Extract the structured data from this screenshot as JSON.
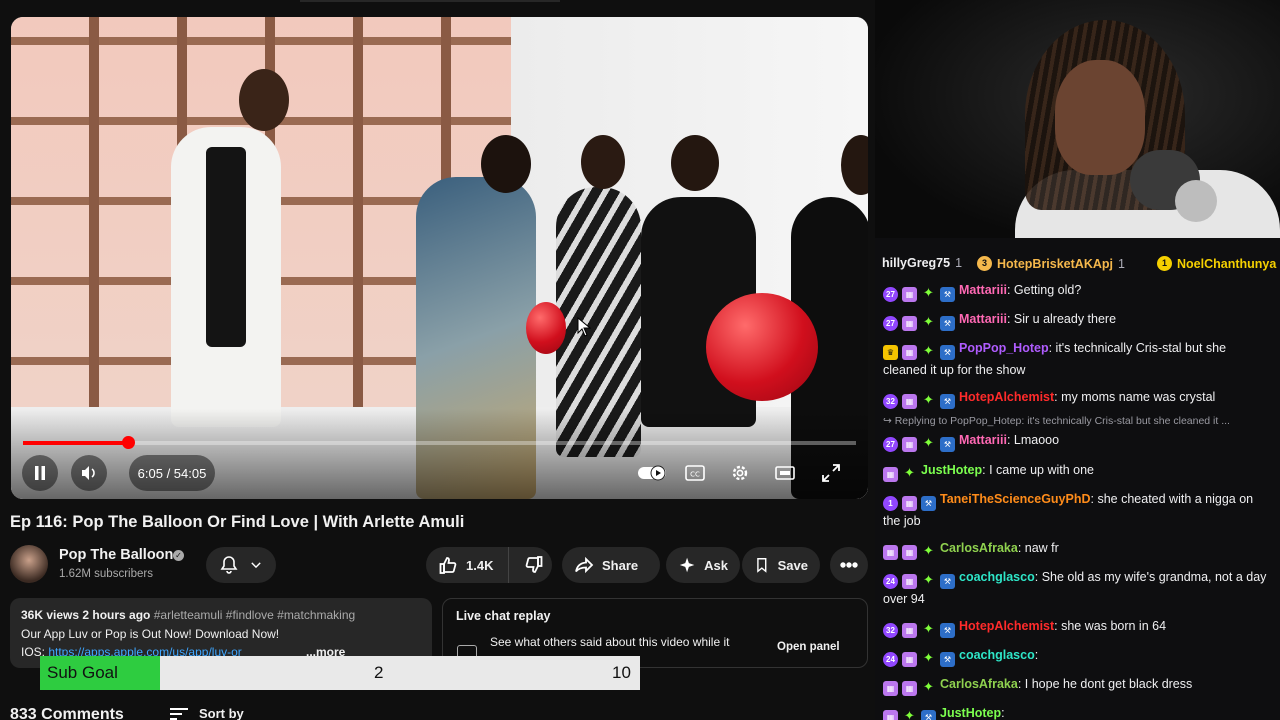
{
  "player": {
    "progress_fraction": 0.126,
    "time_display": "6:05 / 54:05"
  },
  "video": {
    "title": "Ep 116: Pop The Balloon Or Find Love | With Arlette Amuli"
  },
  "channel": {
    "name": "Pop The Balloon",
    "subscribers": "1.62M subscribers"
  },
  "actions": {
    "likes": "1.4K",
    "share_label": "Share",
    "ask_label": "Ask",
    "save_label": "Save"
  },
  "description": {
    "meta": "36K views  2 hours ago",
    "tags": "#arletteamuli #findlove #matchmaking",
    "line1": "Our App Luv or Pop is Out Now! Download Now!",
    "ios_prefix": "IOS: ",
    "ios_link": "https://apps.apple.com/us/app/luv-or",
    "more": "...more"
  },
  "live_chat": {
    "title": "Live chat replay",
    "desc": "See what others said about this video while it",
    "button": "Open panel"
  },
  "comments": {
    "count": "833 Comments",
    "sort_label": "Sort by"
  },
  "sub_goal": {
    "label": "Sub Goal",
    "current": "2",
    "target": "10",
    "fraction": 0.2,
    "fill_color": "#2ecc40"
  },
  "hype": [
    {
      "name": "hillyGreg75",
      "count": "1",
      "coin": "",
      "color": "#efeff1"
    },
    {
      "name": "HotepBrisketAKApj",
      "count": "1",
      "coin": "3",
      "color": "#f5b84c"
    },
    {
      "name": "NoelChanthunya",
      "count": "",
      "coin": "1",
      "color": "#f5d000"
    }
  ],
  "chat": [
    {
      "badges": [
        "27",
        "gift",
        "gem",
        "sword"
      ],
      "user": "Mattariii",
      "color": "#ff69b4",
      "text": "Getting old?"
    },
    {
      "badges": [
        "27",
        "gift",
        "gem",
        "sword"
      ],
      "user": "Mattariii",
      "color": "#ff69b4",
      "text": "Sir u already there"
    },
    {
      "badges": [
        "crown",
        "gift",
        "gem",
        "sword"
      ],
      "user": "PopPop_Hotep",
      "color": "#b05cff",
      "text": "it's technically Cris-stal but she cleaned it up for the show"
    },
    {
      "badges": [
        "32",
        "gift",
        "gem",
        "sword"
      ],
      "user": "HotepAlchemist",
      "color": "#ff2b2b",
      "text": "my moms name was crystal"
    },
    {
      "reply": "Replying to PopPop_Hotep: it's technically Cris-stal but she cleaned it ..."
    },
    {
      "badges": [
        "27",
        "gift",
        "gem",
        "sword"
      ],
      "user": "Mattariii",
      "color": "#ff69b4",
      "text": "Lmaooo"
    },
    {
      "badges": [
        "gift",
        "gem"
      ],
      "user": "JustHotep",
      "color": "#7cff4f",
      "text": "I came up with one"
    },
    {
      "badges": [
        "1",
        "gift",
        "sword"
      ],
      "user": "TaneiTheScienceGuyPhD",
      "color": "#ff8c1a",
      "text": "she cheated with a nigga on the job"
    },
    {
      "badges": [
        "gift",
        "gift",
        "gem"
      ],
      "user": "CarlosAfraka",
      "color": "#8fd14f",
      "text": "naw fr"
    },
    {
      "badges": [
        "24",
        "gift",
        "gem",
        "sword"
      ],
      "user": "coachglasco",
      "color": "#2ee6c8",
      "text": "She old as my wife's grandma, not a day over 94"
    },
    {
      "badges": [
        "32",
        "gift",
        "gem",
        "sword"
      ],
      "user": "HotepAlchemist",
      "color": "#ff2b2b",
      "text": "she was born in 64"
    },
    {
      "badges": [
        "24",
        "gift",
        "gem",
        "sword"
      ],
      "user": "coachglasco",
      "color": "#2ee6c8",
      "text": ""
    },
    {
      "badges": [
        "gift",
        "gift",
        "gem"
      ],
      "user": "CarlosAfraka",
      "color": "#8fd14f",
      "text": "I hope he dont get black dress"
    },
    {
      "badges": [
        "gift",
        "gem",
        "sword"
      ],
      "user": "JustHotep",
      "color": "#7cff4f",
      "text": ""
    }
  ]
}
